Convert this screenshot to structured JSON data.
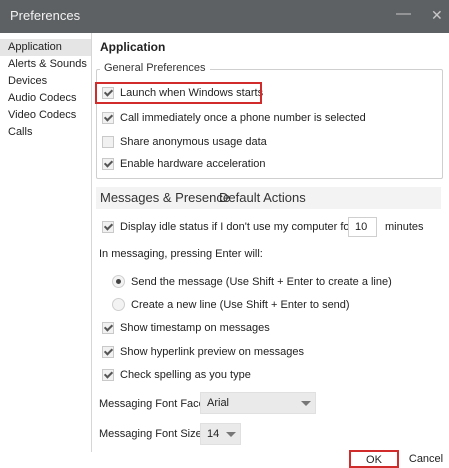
{
  "window": {
    "title": "Preferences",
    "minimize_glyph": "—",
    "close_glyph": "✕"
  },
  "sidebar": {
    "items": [
      {
        "label": "Application"
      },
      {
        "label": "Alerts & Sounds"
      },
      {
        "label": "Devices"
      },
      {
        "label": "Audio Codecs"
      },
      {
        "label": "Video Codecs"
      },
      {
        "label": "Calls"
      }
    ],
    "selected": "Application"
  },
  "main": {
    "title": "Application",
    "general": {
      "legend": "General Preferences",
      "launch_windows": {
        "label": "Launch when Windows starts",
        "checked": true
      },
      "call_immediately": {
        "label": "Call immediately once a phone number is selected",
        "checked": true
      },
      "share_usage": {
        "label": "Share anonymous usage data",
        "checked": false
      },
      "hw_accel": {
        "label": "Enable hardware acceleration",
        "checked": true
      }
    },
    "tabs": {
      "active": "Messages & Presence",
      "other": "Default Actions"
    },
    "messaging": {
      "idle": {
        "label": "Display idle status if I don't use my computer for:",
        "checked": true,
        "value": "10",
        "unit": "minutes"
      },
      "enter_label": "In messaging, pressing Enter will:",
      "radio_send": {
        "label": "Send the message (Use Shift + Enter to create a line)",
        "checked": true
      },
      "radio_newline": {
        "label": "Create a new line (Use Shift + Enter to send)",
        "checked": false
      },
      "timestamp": {
        "label": "Show timestamp on messages",
        "checked": true
      },
      "hyperlink": {
        "label": "Show hyperlink preview on messages",
        "checked": true
      },
      "spelling": {
        "label": "Check spelling as you type",
        "checked": true
      },
      "font_face": {
        "label": "Messaging Font Face:",
        "value": "Arial"
      },
      "font_size": {
        "label": "Messaging Font Size:",
        "value": "14"
      }
    }
  },
  "footer": {
    "ok": "OK",
    "cancel": "Cancel"
  },
  "colors": {
    "titlebar": "#5e6164",
    "highlight": "#d12b2b"
  }
}
